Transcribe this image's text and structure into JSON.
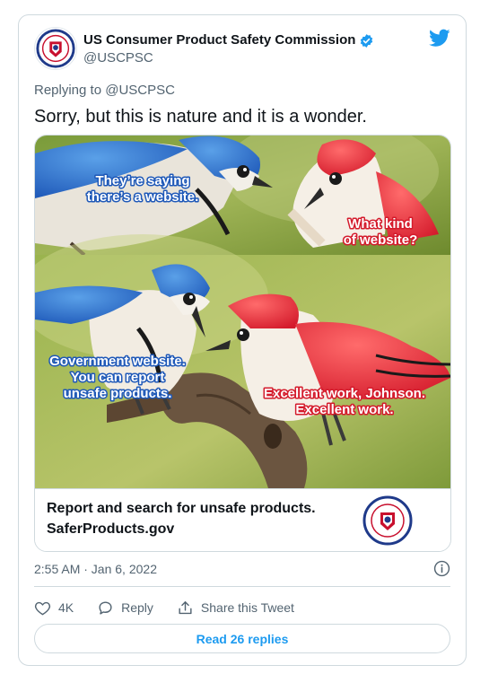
{
  "author": {
    "name": "US Consumer Product Safety Commission",
    "handle": "@USCPSC"
  },
  "reply_to": {
    "prefix": "Replying to",
    "handle": "@USCPSC"
  },
  "tweet_text": "Sorry, but this is nature and it is a wonder.",
  "meme": {
    "top_left": [
      "They’re saying",
      "there’s a website."
    ],
    "top_right": [
      "What kind",
      "of website?"
    ],
    "bottom_left": [
      "Government website.",
      "You can report",
      "unsafe products."
    ],
    "bottom_right": [
      "Excellent work, Johnson.",
      "Excellent work."
    ]
  },
  "link_card": {
    "line1": "Report and search for unsafe products.",
    "line2": "SaferProducts.gov"
  },
  "timestamp": "2:55 AM · Jan 6, 2022",
  "actions": {
    "likes": "4K",
    "reply_label": "Reply",
    "share_label": "Share this Tweet"
  },
  "read_replies": "Read 26 replies",
  "colors": {
    "accent": "#1d9bf0",
    "secondary_text": "#536471",
    "border": "#cfd9de"
  },
  "icons": [
    "twitter-bird-icon",
    "verified-badge-icon",
    "info-icon",
    "heart-icon",
    "reply-bubble-icon",
    "share-icon"
  ]
}
